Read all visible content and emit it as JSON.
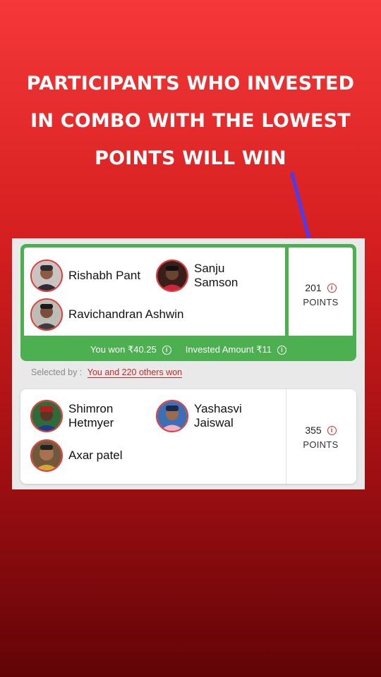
{
  "headline": {
    "line1": "PARTICIPANTS WHO INVESTED",
    "line2": "IN COMBO WITH THE LOWEST",
    "line3": "POINTS WILL WIN"
  },
  "colors": {
    "background_top": "#f53838",
    "background_bottom": "#620407",
    "winner_green": "#4caf50",
    "accent_red": "#e53935",
    "arrow": "#4a3df0"
  },
  "combos": [
    {
      "players": [
        "Rishabh Pant",
        "Sanju Samson",
        "Ravichandran Ashwin"
      ],
      "points_value": "201",
      "points_label": "POINTS",
      "won_text": "You won ₹40.25",
      "invested_text": "Invested Amount ₹11",
      "selected_label": "Selected by :",
      "selected_value": "You and 220 others won"
    },
    {
      "players": [
        "Shimron Hetmyer",
        "Yashasvi Jaiswal",
        "Axar patel"
      ],
      "points_value": "355",
      "points_label": "POINTS"
    }
  ],
  "icons": {
    "info": "info-icon",
    "arrow": "arrow-down-icon",
    "avatar": "player-avatar"
  }
}
